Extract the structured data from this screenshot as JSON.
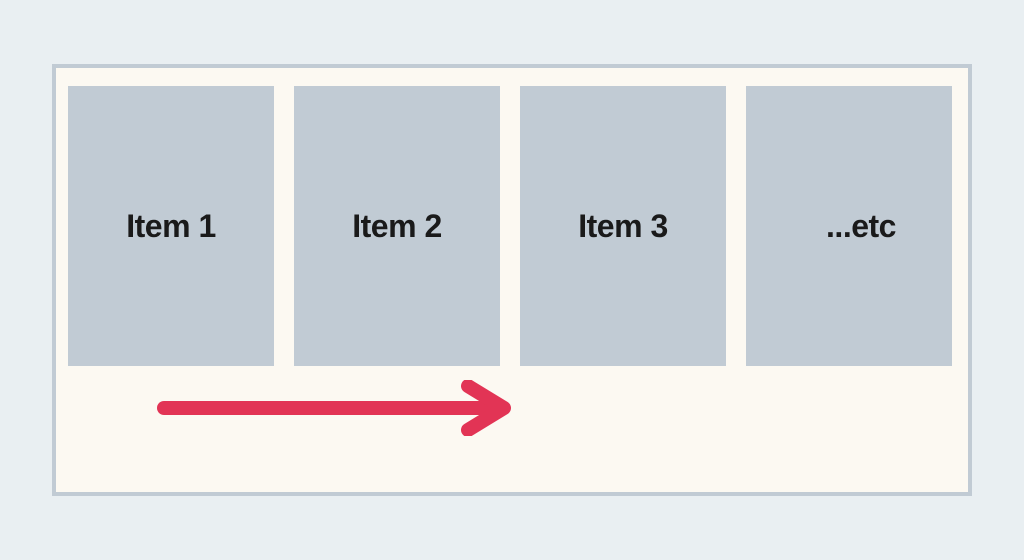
{
  "items": [
    {
      "label": "Item 1"
    },
    {
      "label": "Item 2"
    },
    {
      "label": "Item 3"
    },
    {
      "label": "...etc"
    }
  ],
  "colors": {
    "page_bg": "#e9eff2",
    "container_bg": "#fcf9f2",
    "container_border": "#c1cbd4",
    "item_bg": "#c1cbd4",
    "arrow": "#e23455",
    "text": "#1a1a1a"
  }
}
